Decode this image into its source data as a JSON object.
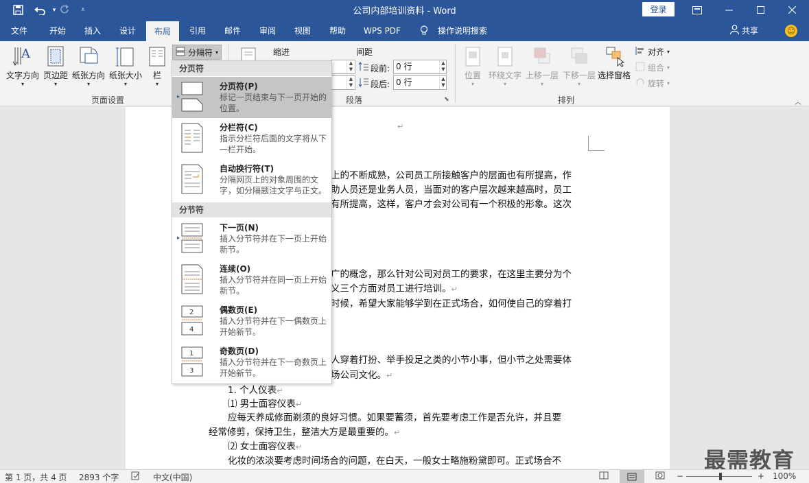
{
  "titlebar": {
    "title": "公司内部培训资料 - Word",
    "login_label": "登录",
    "save_icon": "save-icon",
    "undo_icon": "undo-icon",
    "redo_icon": "redo-icon",
    "customize_icon": "customize-quick-access-icon"
  },
  "tabs": [
    {
      "label": "文件"
    },
    {
      "label": "开始"
    },
    {
      "label": "插入"
    },
    {
      "label": "设计"
    },
    {
      "label": "布局"
    },
    {
      "label": "引用"
    },
    {
      "label": "邮件"
    },
    {
      "label": "审阅"
    },
    {
      "label": "视图"
    },
    {
      "label": "帮助"
    },
    {
      "label": "WPS PDF"
    },
    {
      "label": "操作说明搜索"
    }
  ],
  "share_label": "共享",
  "ribbon": {
    "page_setup": {
      "text_direction": "文字方向",
      "margins": "页边距",
      "orientation": "纸张方向",
      "size": "纸张大小",
      "columns": "栏",
      "breaks": "分隔符",
      "group_label": "页面设置"
    },
    "paragraph": {
      "indent_label": "缩进",
      "spacing_label": "间距",
      "before_label": "段前:",
      "before_value": "0 行",
      "after_label": "段后:",
      "after_value": "0 行",
      "group_label": "段落"
    },
    "arrange": {
      "position": "位置",
      "wrap_text": "环绕文字",
      "bring_forward": "上移一层",
      "send_backward": "下移一层",
      "selection_pane": "选择窗格",
      "align": "对齐",
      "group": "组合",
      "rotate": "旋转",
      "group_label": "排列"
    }
  },
  "menu": {
    "page_breaks_header": "分页符",
    "section_breaks_header": "分节符",
    "items": [
      {
        "name": "分页符(P)",
        "desc": "标记一页结束与下一页开始的位置。"
      },
      {
        "name": "分栏符(C)",
        "desc": "指示分栏符后面的文字将从下一栏开始。"
      },
      {
        "name": "自动换行符(T)",
        "desc": "分隔网页上的对象周围的文字，如分隔题注文字与正文。"
      },
      {
        "name": "下一页(N)",
        "desc": "插入分节符并在下一页上开始新节。"
      },
      {
        "name": "连续(O)",
        "desc": "插入分节符并在同一页上开始新节。"
      },
      {
        "name": "偶数页(E)",
        "desc": "插入分节符并在下一偶数页上开始新节。"
      },
      {
        "name": "奇数页(D)",
        "desc": "插入分节符并在下一奇数页上开始新节。"
      }
    ]
  },
  "document": {
    "lines": [
      "上的不断成熟，公司员工所接触客户的层面也有所提高，作",
      "助人员还是业务人员，当面对的客户层次越来越高时，员工",
      "有所提高，这样，客户才会对公司有一个积极的形象。这次",
      "广的概念，那么针对公司对员工的要求，在这里主要分为个",
      "义三个方面对员工进行培训。",
      "时候，希望大家能够学到在正式场合，如何使自己的穿着打",
      "人穿着打扮、举手投足之类的小节小事，但小节之处需要体",
      "场公司文化。",
      "1.  个人仪表",
      "⑴ 男士面容仪表",
      "应每天养成修面剃须的良好习惯。如果要蓄须，首先要考虑工作是否允许，并且要",
      "经常修剪，保持卫生，整洁大方是最重要的。",
      "⑵ 女士面容仪表",
      "化妆的浓淡要考虑时间场合的问题，在白天，一般女士略施粉黛即可。正式场合不"
    ]
  },
  "status": {
    "page": "第 1 页，共 4 页",
    "words": "2893 个字",
    "language": "中文(中国)",
    "zoom": "100%",
    "zoom_level_percent": 100
  },
  "watermark": "最需教育",
  "colors": {
    "brand": "#2b579a",
    "ribbon_bg": "#f3f3f3",
    "accent_orange": "#d9822b"
  }
}
